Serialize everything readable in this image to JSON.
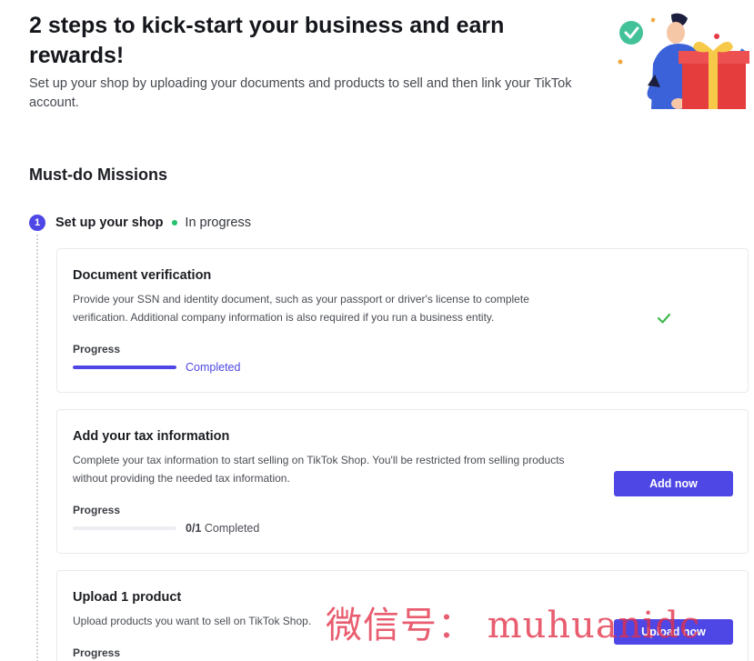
{
  "hero": {
    "title": "2 steps to kick-start your business and earn rewards!",
    "subtitle": "Set up your shop by uploading your documents and products to sell and then link your TikTok account."
  },
  "section": {
    "title": "Must-do Missions"
  },
  "step": {
    "number": "1",
    "label": "Set up your shop",
    "status": "In progress",
    "status_color": "#23c16b"
  },
  "cards": [
    {
      "title": "Document verification",
      "description": "Provide your SSN and identity document, such as your passport or driver's license to complete verification. Additional company information is also required if you run a business entity.",
      "progress_label": "Progress",
      "progress_fraction": 1.0,
      "progress_text": "Completed",
      "state_icon": "check-icon"
    },
    {
      "title": "Add your tax information",
      "description": "Complete your tax information to start selling on TikTok Shop. You'll be restricted from selling products without providing the needed tax information.",
      "progress_label": "Progress",
      "progress_fraction": 0.0,
      "progress_count": "0/1",
      "progress_text": "Completed",
      "button_label": "Add now"
    },
    {
      "title": "Upload 1 product",
      "description": "Upload products you want to sell on TikTok Shop.",
      "progress_label": "Progress",
      "button_label": "Upload now"
    }
  ],
  "watermark": "微信号： muhuanidc",
  "colors": {
    "accent": "#4e47e5",
    "success": "#23c16b",
    "check": "#3fb950"
  }
}
